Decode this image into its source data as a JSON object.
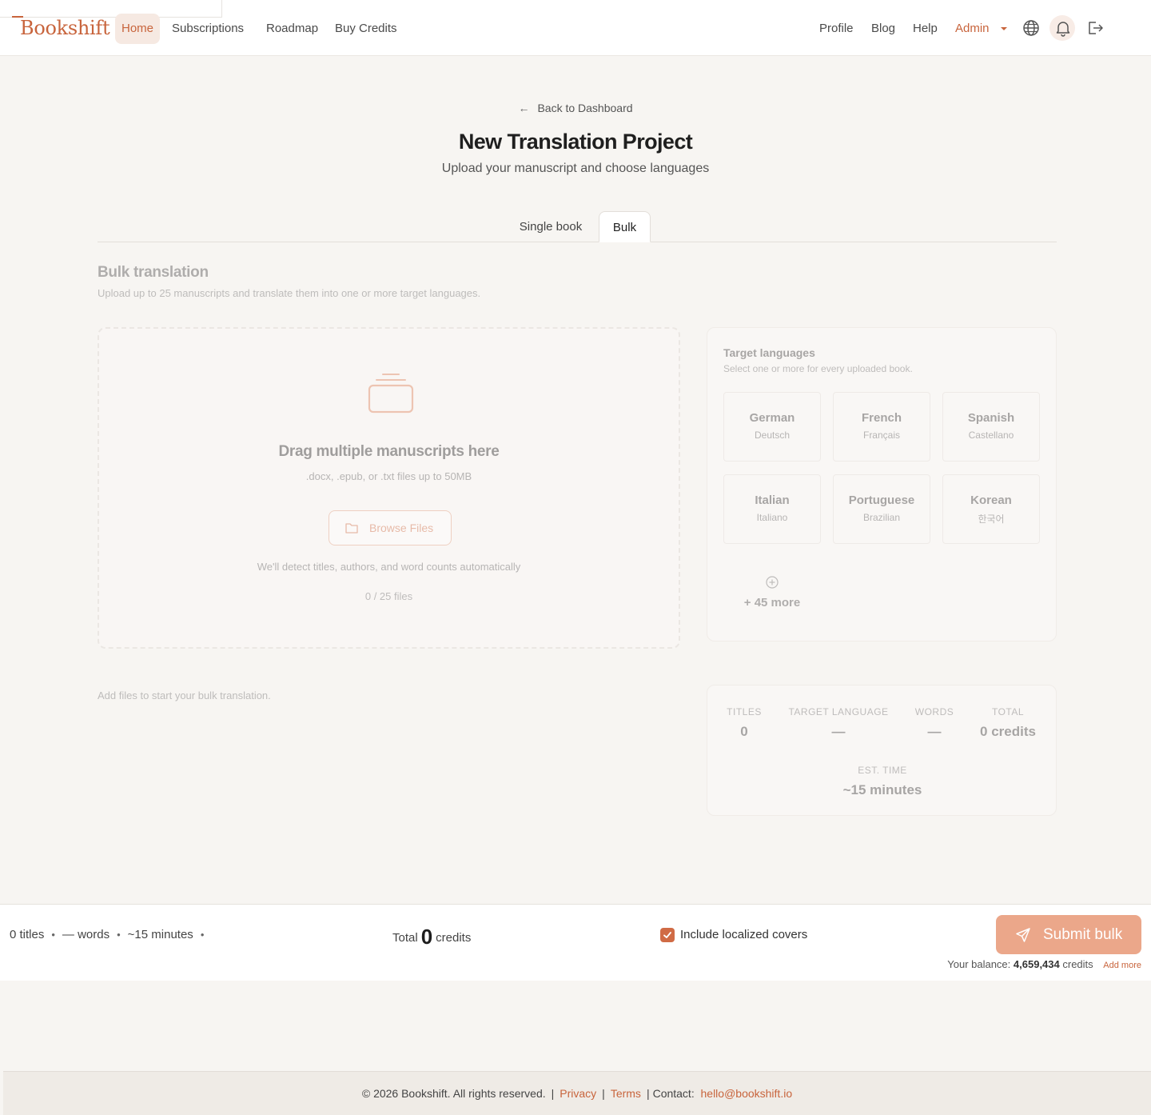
{
  "brand": {
    "name": "Bookshift",
    "accent": "#c8643c"
  },
  "nav": {
    "left": [
      {
        "label": "Home",
        "active": true
      },
      {
        "label": "Subscriptions"
      },
      {
        "label": "Roadmap"
      },
      {
        "label": "Buy Credits"
      }
    ],
    "right": [
      {
        "label": "Profile"
      },
      {
        "label": "Blog"
      },
      {
        "label": "Help"
      },
      {
        "label": "Admin"
      }
    ],
    "icons": [
      "globe-icon",
      "bell-icon",
      "logout-icon"
    ]
  },
  "header": {
    "back_label": "Back to Dashboard",
    "title": "New Translation Project",
    "subtitle": "Upload your manuscript and choose languages"
  },
  "tabs": [
    {
      "label": "Single book",
      "active": false
    },
    {
      "label": "Bulk",
      "active": true
    }
  ],
  "bulk": {
    "title": "Bulk translation",
    "subtitle": "Upload up to 25 manuscripts and translate them into one or more target languages.",
    "dropzone": {
      "title": "Drag multiple manuscripts here",
      "formats": ".docx, .epub, or .txt files up to 50MB",
      "browse_label": "Browse Files",
      "note": "We'll detect titles, authors, and word counts automatically",
      "count": "0 / 25 files"
    },
    "empty_hint": "Add files to start your bulk translation."
  },
  "languages": {
    "title": "Target languages",
    "subtitle": "Select one or more for every uploaded book.",
    "items": [
      {
        "name": "German",
        "native": "Deutsch"
      },
      {
        "name": "French",
        "native": "Français"
      },
      {
        "name": "Spanish",
        "native": "Castellano"
      },
      {
        "name": "Italian",
        "native": "Italiano"
      },
      {
        "name": "Portuguese",
        "native": "Brazilian"
      },
      {
        "name": "Korean",
        "native": "한국어"
      }
    ],
    "more_label": "+ 45 more"
  },
  "summary": {
    "titles_label": "TITLES",
    "titles_value": "0",
    "target_label": "TARGET LANGUAGE",
    "target_value": "—",
    "words_label": "WORDS",
    "words_value": "—",
    "total_label": "TOTAL",
    "total_value": "0 credits",
    "time_label": "EST. TIME",
    "time_value": "~15 minutes"
  },
  "action_bar": {
    "titles": "0 titles",
    "words": "— words",
    "time": "~15 minutes",
    "total_prefix": "Total",
    "total_value": "0",
    "total_suffix": "credits",
    "covers_label": "Include localized covers",
    "covers_checked": true,
    "submit_label": "Submit bulk",
    "balance_prefix": "Your balance:",
    "balance_value": "4,659,434",
    "balance_suffix": "credits",
    "add_more": "Add more"
  },
  "footer": {
    "copyright": "© 2026 Bookshift. All rights reserved.",
    "privacy": "Privacy",
    "terms": "Terms",
    "contact_label": "Contact:",
    "email": "hello@bookshift.io"
  }
}
